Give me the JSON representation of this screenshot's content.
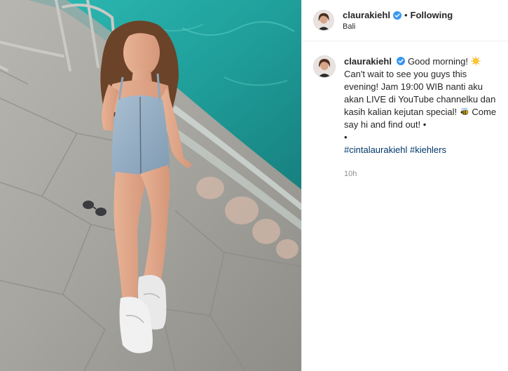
{
  "post": {
    "author": {
      "username": "claurakiehl",
      "verified": true,
      "follow_status": "Following",
      "location": "Bali"
    },
    "caption": {
      "username": "claurakiehl",
      "line1": "Good morning!",
      "line2": "Can't wait to see you guys this evening! Jam 19:00 WIB nanti aku akan LIVE di YouTube channelku dan kasih kalian kejutan special!",
      "line3": "Come say hi and find out! •",
      "line4": "•",
      "hashtags": [
        "#cintalaurakiehl",
        "#kiehlers"
      ],
      "timestamp": "10h"
    },
    "icons": {
      "verified": "verified-badge-icon",
      "sun_emoji": "sun-emoji-icon",
      "bee_emoji": "bee-emoji-icon"
    },
    "colors": {
      "verified_blue": "#3897f0",
      "link": "#00376b",
      "muted": "#8e8e8e",
      "text": "#262626",
      "border": "#efefef"
    }
  }
}
